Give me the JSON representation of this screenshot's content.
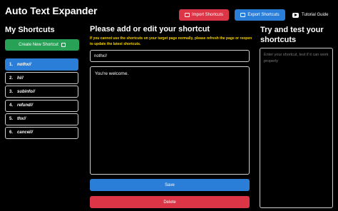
{
  "app": {
    "title": "Auto Text Expander"
  },
  "toolbar": {
    "import_label": "Import Shortcuts",
    "export_label": "Export Shortcuts",
    "tutorial_label": "Tutorial Guide"
  },
  "sidebar": {
    "heading": "My Shortcuts",
    "create_label": "Create New Shortcut",
    "items": [
      {
        "num": "1.",
        "name": "nothx//",
        "active": true
      },
      {
        "num": "2.",
        "name": "hi//",
        "active": false
      },
      {
        "num": "3.",
        "name": "subinfo//",
        "active": false
      },
      {
        "num": "4.",
        "name": "refund//",
        "active": false
      },
      {
        "num": "5.",
        "name": "thx//",
        "active": false
      },
      {
        "num": "6.",
        "name": "cancel//",
        "active": false
      }
    ]
  },
  "editor": {
    "heading": "Please add or edit your shortcut",
    "notice": "If you cannot use the shortcuts on your target page normally, please refresh the page or reopen to update the latest shortcuts.",
    "shortcut_value": "nothx//",
    "expansion_text": "You're welcome.",
    "save_label": "Save",
    "delete_label": "Delete"
  },
  "tester": {
    "heading": "Try and test your shortcuts",
    "placeholder": "Enter your shortcut, test if it can work properly"
  },
  "colors": {
    "import": "#dc3545",
    "export": "#2b7ed8",
    "create": "#27a155",
    "active_item": "#2b7ed8",
    "notice": "#f5d000"
  }
}
